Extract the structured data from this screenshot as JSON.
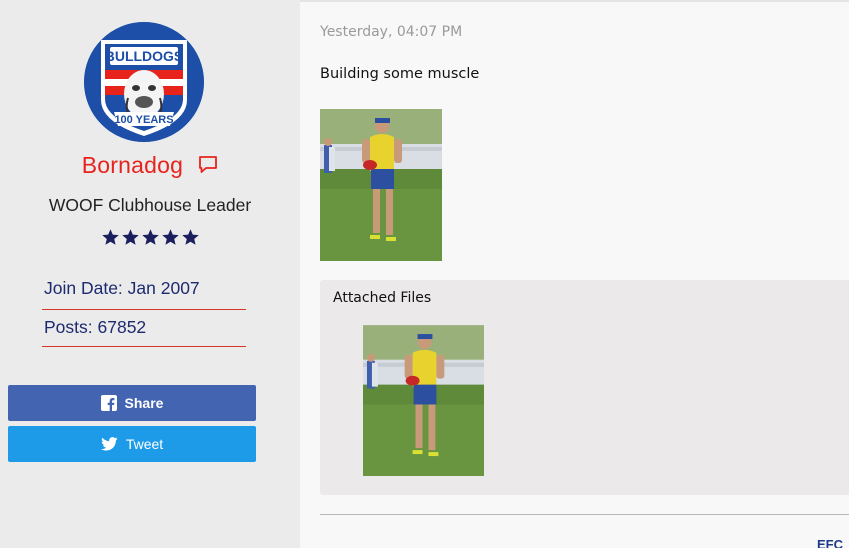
{
  "user": {
    "avatar_icon": "bulldogs-100-years-logo-icon",
    "avatar_text_top": "BULLDOGS",
    "avatar_text_bottom": "100 YEARS",
    "username": "Bornadog",
    "title": "WOOF Clubhouse Leader",
    "rank_stars": 5,
    "join_date": "Join Date: Jan 2007",
    "posts": "Posts: 67852"
  },
  "share": {
    "share_label": "Share",
    "share_icon": "facebook-icon",
    "tweet_label": "Tweet",
    "tweet_icon": "twitter-icon"
  },
  "post": {
    "timestamp": "Yesterday, 04:07 PM",
    "text": "Building some muscle",
    "image_alt": "football player training photo"
  },
  "attachments": {
    "title": "Attached Files"
  },
  "footer": {
    "cut_text": "EFC"
  },
  "colors": {
    "username": "#e8231c",
    "info_text": "#1d2a6e",
    "divider_red": "#d9342b",
    "share_blue": "#4264b1",
    "tweet_blue": "#1d9be8",
    "star_navy": "#1b1f5e"
  }
}
